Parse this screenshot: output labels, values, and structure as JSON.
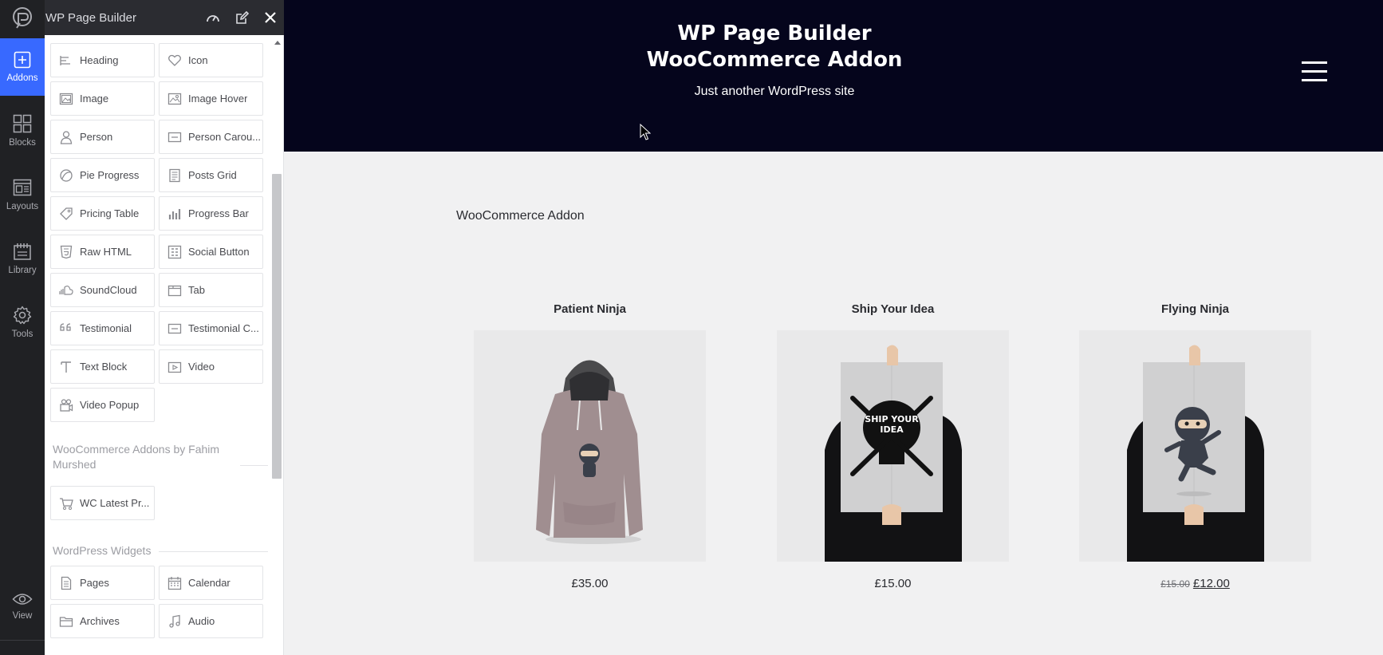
{
  "app": {
    "title": "WP Page Builder"
  },
  "rail": {
    "items": [
      {
        "label": "Addons",
        "icon": "plus-square-icon",
        "active": true
      },
      {
        "label": "Blocks",
        "icon": "blocks-icon",
        "active": false
      },
      {
        "label": "Layouts",
        "icon": "layouts-icon",
        "active": false
      },
      {
        "label": "Library",
        "icon": "library-icon",
        "active": false
      },
      {
        "label": "Tools",
        "icon": "gear-icon",
        "active": false
      }
    ],
    "view_label": "View"
  },
  "panel": {
    "addons": [
      {
        "label": "Heading",
        "icon": "heading-icon"
      },
      {
        "label": "Icon",
        "icon": "heart-icon"
      },
      {
        "label": "Image",
        "icon": "image-icon"
      },
      {
        "label": "Image Hover",
        "icon": "image-hover-icon"
      },
      {
        "label": "Person",
        "icon": "person-icon"
      },
      {
        "label": "Person Carou...",
        "icon": "carousel-icon"
      },
      {
        "label": "Pie Progress",
        "icon": "pie-progress-icon"
      },
      {
        "label": "Posts Grid",
        "icon": "posts-grid-icon"
      },
      {
        "label": "Pricing Table",
        "icon": "price-tag-icon"
      },
      {
        "label": "Progress Bar",
        "icon": "progress-bar-icon"
      },
      {
        "label": "Raw HTML",
        "icon": "html5-icon"
      },
      {
        "label": "Social Button",
        "icon": "social-button-icon"
      },
      {
        "label": "SoundCloud",
        "icon": "soundcloud-icon"
      },
      {
        "label": "Tab",
        "icon": "tab-icon"
      },
      {
        "label": "Testimonial",
        "icon": "quote-icon"
      },
      {
        "label": "Testimonial C...",
        "icon": "carousel-icon"
      },
      {
        "label": "Text Block",
        "icon": "text-block-icon"
      },
      {
        "label": "Video",
        "icon": "video-icon"
      },
      {
        "label": "Video Popup",
        "icon": "video-camera-icon"
      }
    ],
    "woo_section_title": "WooCommerce Addons by Fahim Murshed",
    "woo_addons": [
      {
        "label": "WC Latest Pr...",
        "icon": "cart-icon"
      }
    ],
    "wp_section_title": "WordPress Widgets",
    "wp_widgets": [
      {
        "label": "Pages",
        "icon": "page-icon"
      },
      {
        "label": "Calendar",
        "icon": "calendar-icon"
      },
      {
        "label": "Archives",
        "icon": "folder-icon"
      },
      {
        "label": "Audio",
        "icon": "music-note-icon"
      }
    ]
  },
  "site": {
    "title_line1": "WP Page Builder",
    "title_line2": "WooCommerce Addon",
    "tagline": "Just another WordPress site",
    "page_heading": "WooCommerce Addon",
    "products": [
      {
        "name": "Patient Ninja",
        "price": "£35.00",
        "old_price": ""
      },
      {
        "name": "Ship Your Idea",
        "price": "£15.00",
        "old_price": ""
      },
      {
        "name": "Flying Ninja",
        "price": "£12.00",
        "old_price": "£15.00"
      }
    ],
    "colors": {
      "header_bg": "#05051c",
      "accent": "#3869ff",
      "rail_bg": "#202124"
    }
  }
}
